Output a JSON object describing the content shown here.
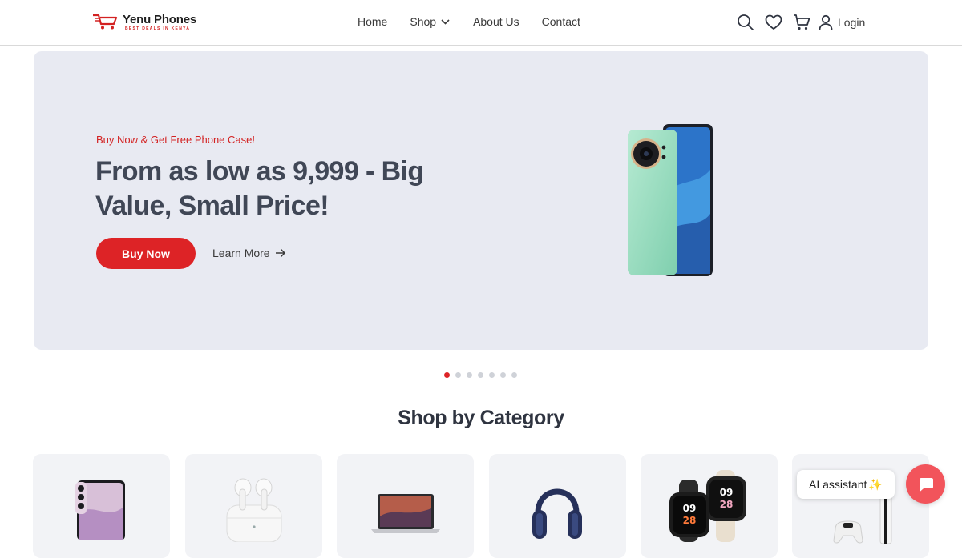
{
  "brand": {
    "name": "Yenu Phones",
    "tagline": "BEST DEALS IN KENYA",
    "accent_color": "#dd2326"
  },
  "nav": {
    "items": [
      {
        "label": "Home"
      },
      {
        "label": "Shop",
        "has_dropdown": true
      },
      {
        "label": "About Us"
      },
      {
        "label": "Contact"
      }
    ]
  },
  "header_icons": [
    "search-icon",
    "heart-icon",
    "cart-icon",
    "user-icon"
  ],
  "login_label": "Login",
  "hero": {
    "subtitle": "Buy Now & Get Free Phone Case!",
    "title": "From as low as 9,999 - Big Value, Small Price!",
    "primary_button": "Buy Now",
    "secondary_link": "Learn More",
    "background_color": "#e8eaf2"
  },
  "carousel": {
    "slide_count": 7,
    "active_index": 0
  },
  "categories": {
    "title": "Shop by Category",
    "items": [
      {
        "icon": "smartphone-icon"
      },
      {
        "icon": "earbuds-icon"
      },
      {
        "icon": "laptop-icon"
      },
      {
        "icon": "headphones-icon"
      },
      {
        "icon": "smartwatch-icon"
      },
      {
        "icon": "game-console-icon"
      }
    ]
  },
  "assistant": {
    "label": "AI assistant",
    "sparkle": "✨",
    "chat_color": "#f2545b"
  }
}
